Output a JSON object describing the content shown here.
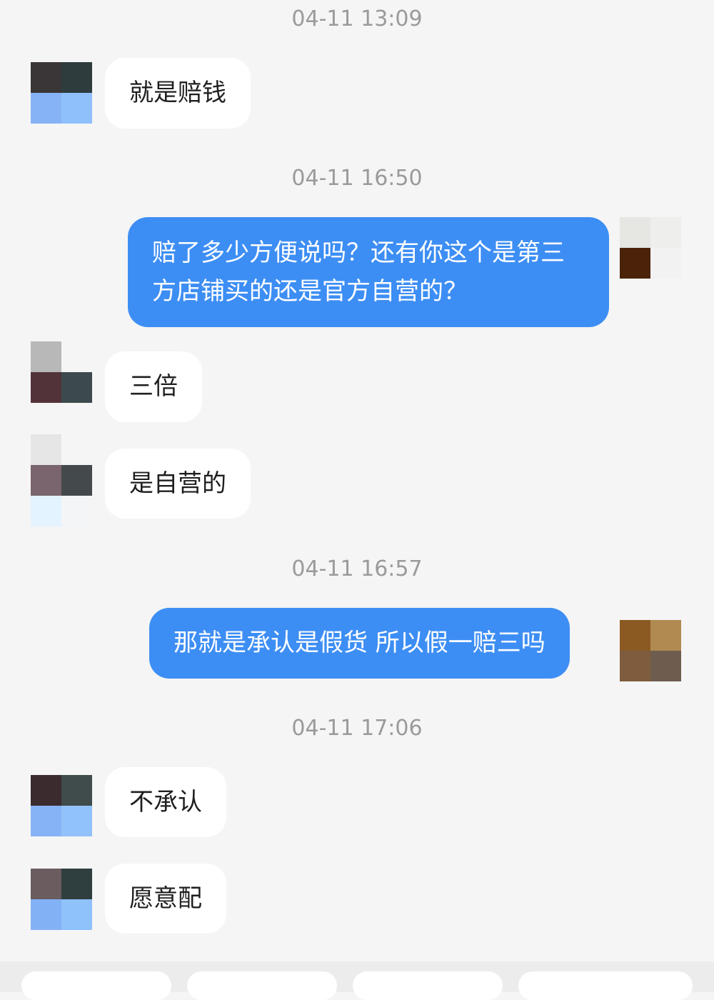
{
  "chat": {
    "timestamps": [
      "04-11 13:09",
      "04-11 16:50",
      "04-11 16:57",
      "04-11 17:06"
    ],
    "messages": [
      {
        "side": "in",
        "text": "就是赔钱"
      },
      {
        "side": "out",
        "text": "赔了多少方便说吗？还有你这个是第三方店铺买的还是官方自营的？"
      },
      {
        "side": "in",
        "text": "三倍"
      },
      {
        "side": "in",
        "text": "是自营的"
      },
      {
        "side": "out",
        "text": "那就是承认是假货 所以假一赔三吗"
      },
      {
        "side": "in",
        "text": "不承认"
      },
      {
        "side": "in",
        "text": "愿意配"
      }
    ]
  },
  "colors": {
    "background": "#f5f5f5",
    "incoming_bubble": "#ffffff",
    "outgoing_bubble": "#3d8ef4",
    "timestamp": "#9a9a9a"
  },
  "avatars": {
    "blurred": true
  }
}
